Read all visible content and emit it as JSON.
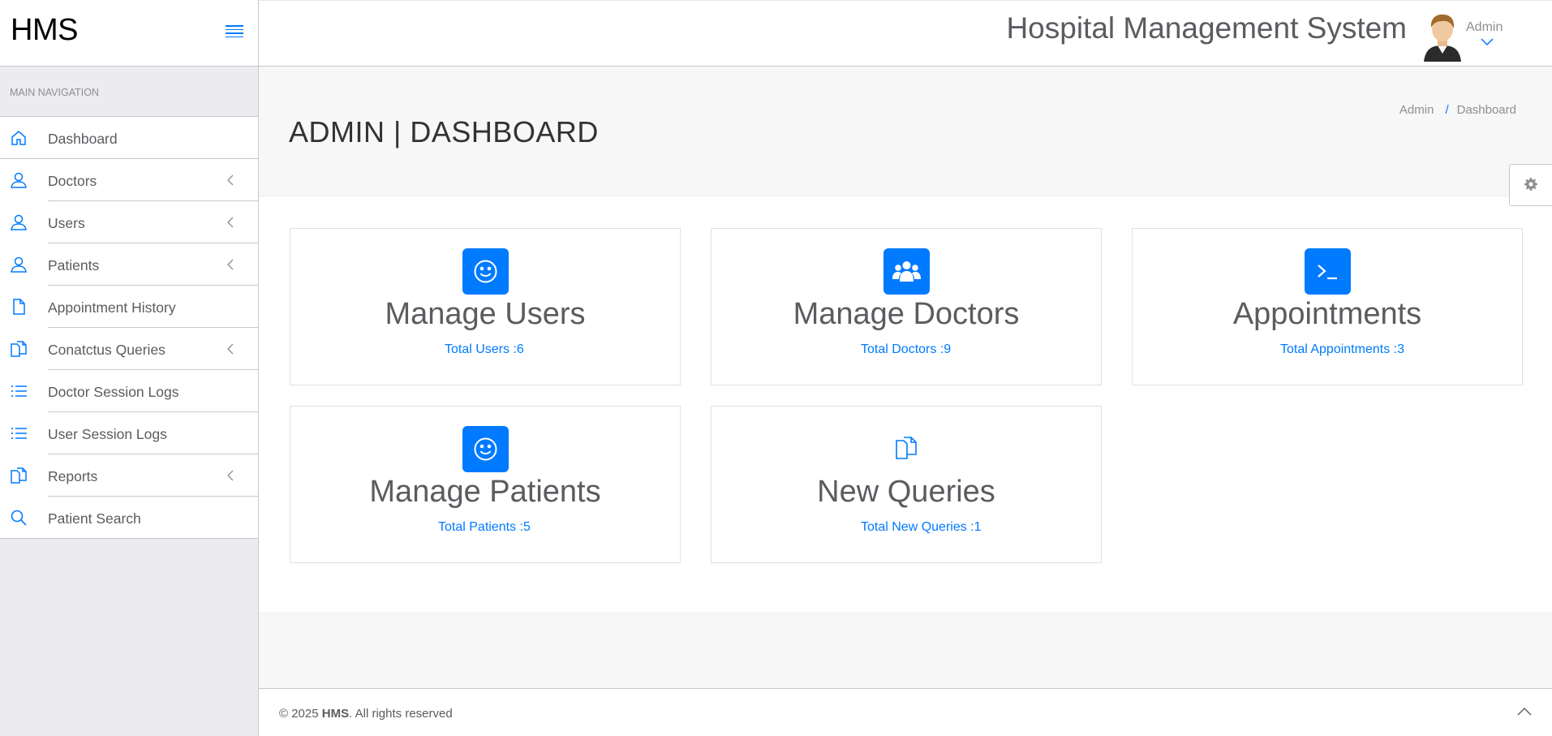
{
  "brand": {
    "name": "HMS"
  },
  "header": {
    "system_title": "Hospital Management System",
    "user_name": "Admin"
  },
  "sidebar": {
    "section_title": "MAIN NAVIGATION",
    "items": [
      {
        "label": "Dashboard",
        "icon": "home-icon",
        "has_submenu": false
      },
      {
        "label": "Doctors",
        "icon": "user-icon",
        "has_submenu": true
      },
      {
        "label": "Users",
        "icon": "user-icon",
        "has_submenu": true
      },
      {
        "label": "Patients",
        "icon": "user-icon",
        "has_submenu": true
      },
      {
        "label": "Appointment History",
        "icon": "file-icon",
        "has_submenu": false
      },
      {
        "label": "Conatctus Queries",
        "icon": "files-icon",
        "has_submenu": true
      },
      {
        "label": "Doctor Session Logs",
        "icon": "list-icon",
        "has_submenu": false
      },
      {
        "label": "User Session Logs",
        "icon": "list-icon",
        "has_submenu": false
      },
      {
        "label": "Reports",
        "icon": "files-icon",
        "has_submenu": true
      },
      {
        "label": "Patient Search",
        "icon": "search-icon",
        "has_submenu": false
      }
    ]
  },
  "page": {
    "title": "ADMIN | DASHBOARD",
    "breadcrumb": [
      "Admin",
      "Dashboard"
    ]
  },
  "cards": [
    {
      "title": "Manage Users",
      "link": "Total Users :6",
      "icon": "smile-icon"
    },
    {
      "title": "Manage Doctors",
      "link": "Total Doctors :9",
      "icon": "users-group-icon"
    },
    {
      "title": "Appointments",
      "link": "Total Appointments :3",
      "icon": "terminal-icon"
    },
    {
      "title": "Manage Patients",
      "link": "Total Patients :5",
      "icon": "smile-icon"
    },
    {
      "title": "New Queries",
      "link": "Total New Queries :1",
      "icon": "files-icon"
    }
  ],
  "footer": {
    "copyright": "© 2025 ",
    "brand": "HMS",
    "rights": ". All rights reserved"
  },
  "colors": {
    "accent": "#007aff",
    "sidebar_bg": "#ececf0",
    "text": "#5b5b60"
  }
}
